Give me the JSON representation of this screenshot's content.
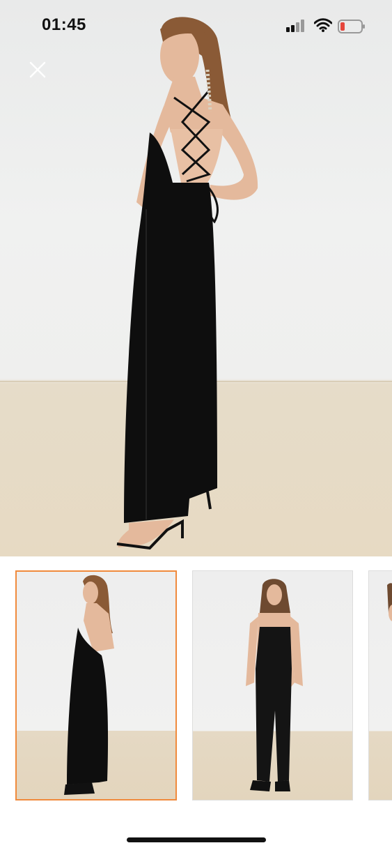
{
  "status_bar": {
    "time": "01:45",
    "signal_icon": "cellular-signal-icon",
    "wifi_icon": "wifi-icon",
    "battery_icon": "battery-low-icon",
    "battery_color": "#e5463c"
  },
  "viewer": {
    "close_icon": "close-icon",
    "main_image": "product-photo-back-view",
    "thumbnails": [
      {
        "name": "thumbnail-back-view",
        "selected": true
      },
      {
        "name": "thumbnail-front-view",
        "selected": false
      },
      {
        "name": "thumbnail-side-view",
        "selected": false
      }
    ],
    "accent_color": "#f08a3c"
  }
}
